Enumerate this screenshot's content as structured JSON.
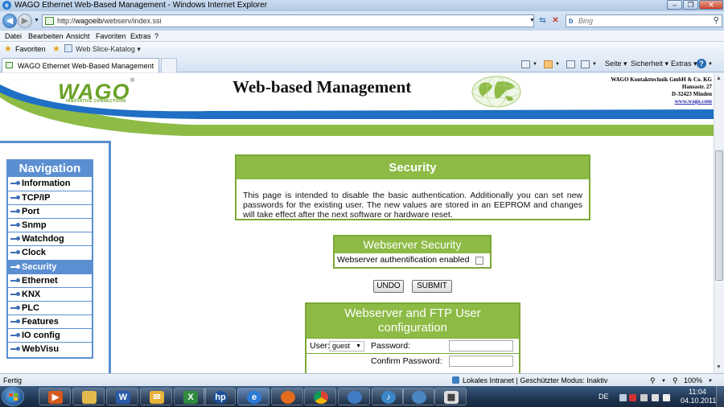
{
  "window": {
    "title": "WAGO Ethernet Web-Based Management - Windows Internet Explorer"
  },
  "address": {
    "url_prefix": "http://",
    "url_host": "wagoeib",
    "url_path": "/webserv/index.ssi"
  },
  "search": {
    "placeholder": "Bing"
  },
  "menu": [
    "Datei",
    "Bearbeiten",
    "Ansicht",
    "Favoriten",
    "Extras",
    "?"
  ],
  "favorites": {
    "label": "Favoriten",
    "slice": "Web Slice-Katalog ▾"
  },
  "tab": {
    "label": "WAGO Ethernet Web-Based Management"
  },
  "commandbar": {
    "page": "Seite ▾",
    "safety": "Sicherheit ▾",
    "tools": "Extras ▾"
  },
  "header": {
    "logo": "WAGO",
    "logo_reg": "®",
    "logo_tagline": "INNOVATIVE CONNECTIONS",
    "title": "Web-based Management",
    "company": [
      "WAGO Kontakttechnik GmbH & Co. KG",
      "Hansastr. 27",
      "D-32423 Minden",
      "www.wago.com"
    ]
  },
  "nav": {
    "title": "Navigation",
    "items": [
      "Information",
      "TCP/IP",
      "Port",
      "Snmp",
      "Watchdog",
      "Clock",
      "Security",
      "Ethernet",
      "KNX",
      "PLC",
      "Features",
      "IO config",
      "WebVisu"
    ],
    "active": "Security"
  },
  "security": {
    "title": "Security",
    "text": "This page is intended to disable the basic authentication. Additionally you can set new passwords for the existing user. The new values are stored in an EEPROM and changes will take effect after the next software or hardware reset."
  },
  "webserver": {
    "title": "Webserver Security",
    "auth_label": "Webserver authentification enabled",
    "auth_enabled": false
  },
  "buttons": {
    "undo": "UNDO",
    "submit": "SUBMIT"
  },
  "ftp": {
    "title_line1": "Webserver and FTP User",
    "title_line2": "configuration",
    "user_label": "User:",
    "user_value": "guest",
    "password_label": "Password:",
    "confirm_label": "Confirm Password:"
  },
  "status": {
    "left": "Fertig",
    "zone": "Lokales Intranet | Geschützter Modus: Inaktiv",
    "zoom": "100%"
  },
  "taskbar": {
    "lang": "DE",
    "time": "11:04",
    "date": "04.10.2011"
  },
  "colors": {
    "wago_green": "#8dbb45",
    "nav_blue": "#5b8fd2",
    "stripe_blue": "#1f6fc4"
  }
}
